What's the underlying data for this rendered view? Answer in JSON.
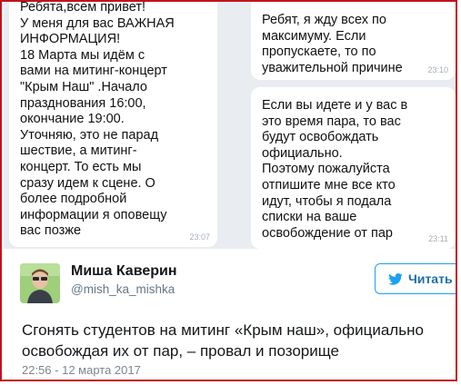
{
  "chat": {
    "left_message": {
      "lines": [
        "Ребята,всем привет!",
        "У меня для вас ВАЖНАЯ",
        "ИНФОРМАЦИЯ!",
        "18 Марта мы идём с",
        "вами на митинг-концерт",
        "\"Крым Наш\" .Начало",
        "празднования 16:00,",
        "окончание 19:00.",
        "Уточняю, это не парад",
        "шествие, а митинг-",
        "концерт. То есть мы",
        "сразу идем к сцене. О",
        "более подробной",
        "информации я оповещу",
        "вас позже"
      ],
      "time": "23:07"
    },
    "right_message_1": {
      "lines": [
        "Ребят, я жду всех по",
        "максимуму. Если",
        "пропускаете, то по",
        "уважительной причине"
      ],
      "time": "23:10"
    },
    "right_message_2": {
      "lines": [
        "Если вы идете и у вас в",
        "это время пара, то вас",
        "будут освобождать",
        "официально.",
        "Поэтому пожалуйста",
        "отпишите мне все кто",
        "идут, чтобы я подала",
        "списки на ваше",
        "освобождение от пар"
      ],
      "time": "23:11"
    }
  },
  "tweet": {
    "author_name": "Миша Каверин",
    "handle": "@mish_ka_mishka",
    "follow_label": "Читать",
    "follow_icon": "twitter-bird-icon",
    "text_lines": [
      "Сгонять студентов на митинг «Крым наш», официально",
      "освобождая их от пар, – провал и позорище"
    ],
    "date": "22:56 - 12 марта 2017"
  },
  "colors": {
    "frame_border": "#c0141b",
    "chat_background": "#e9edf1",
    "twitter_blue": "#1da1f2"
  }
}
